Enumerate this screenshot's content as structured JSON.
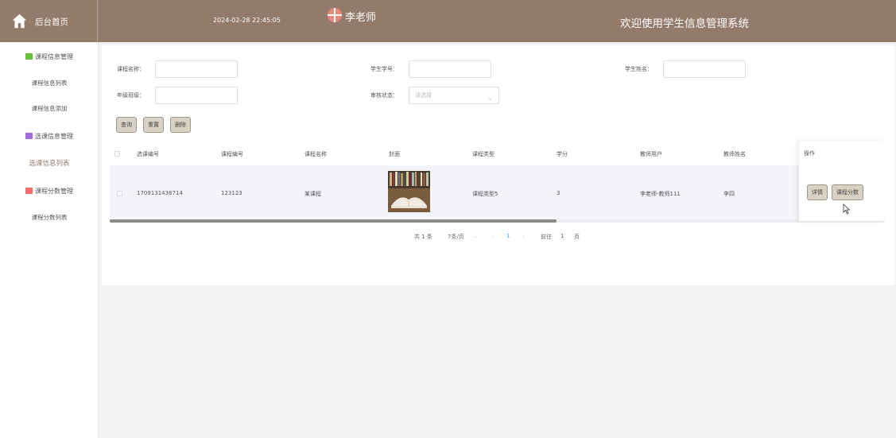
{
  "header": {
    "home_label": "后台首页",
    "datetime": "2024-02-28 22:45:05",
    "username": "李老师",
    "welcome": "欢迎使用学生信息管理系统",
    "bg_color": "#947a6b"
  },
  "sidebar": {
    "groups": [
      {
        "label": "课程信息管理",
        "icon": "chat-icon",
        "color": "#67c23a",
        "items": [
          "课程信息列表",
          "课程信息添加"
        ]
      },
      {
        "label": "选课信息管理",
        "icon": "archive-icon",
        "color": "#9c6ee0",
        "items": [
          "选课信息列表"
        ]
      },
      {
        "label": "课程分数管理",
        "icon": "grid-icon",
        "color": "#f56c6c",
        "items": [
          "课程分数列表"
        ]
      }
    ],
    "active_item": "选课信息列表"
  },
  "search": {
    "course_name_label": "课程名称：",
    "student_no_label": "学生学号：",
    "student_name_label": "学生姓名：",
    "grade_class_label": "年级班级：",
    "review_status_label": "审核状态：",
    "review_status_placeholder": "请选择",
    "buttons": {
      "query": "查询",
      "reset": "重置",
      "delete": "删除"
    }
  },
  "table": {
    "columns": [
      "选课编号",
      "课程编号",
      "课程名称",
      "封面",
      "课程类型",
      "学分",
      "教师用户",
      "教师姓名",
      "操作"
    ],
    "rows": [
      {
        "selection_no": "1709131436714",
        "course_no": "123123",
        "course_name": "某课程",
        "cover": "books-image",
        "course_type": "课程类型5",
        "credit": "3",
        "teacher_user": "李老师-教师111",
        "teacher_name": "李四",
        "actions": [
          "详情",
          "课程分数"
        ]
      }
    ]
  },
  "pagination": {
    "total": "共 1 条",
    "page_size": "7条/页",
    "current_page": "1",
    "goto_label": "前往",
    "goto_value": "1",
    "page_suffix": "页"
  }
}
